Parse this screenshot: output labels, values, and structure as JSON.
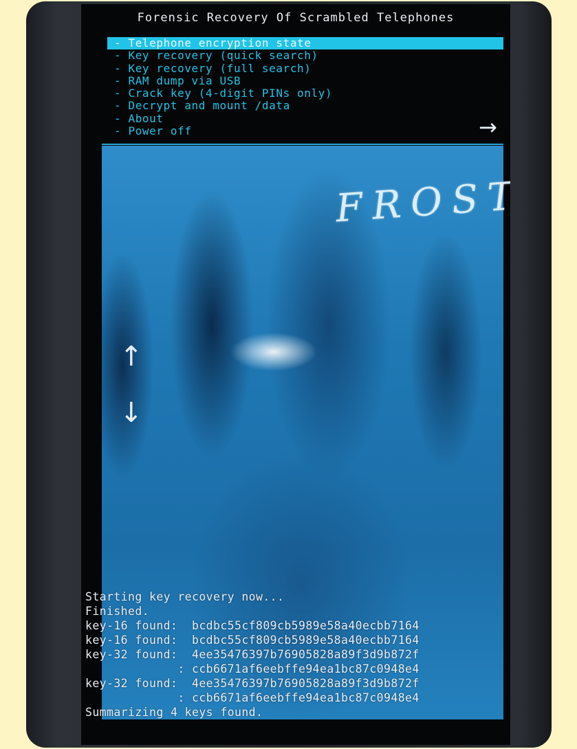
{
  "app": {
    "title": "Forensic Recovery Of Scrambled Telephones",
    "logo_text": "FROST"
  },
  "menu": {
    "selected_index": 0,
    "items": [
      {
        "label": "- Telephone encryption state"
      },
      {
        "label": "- Key recovery (quick search)"
      },
      {
        "label": "- Key recovery (full search)"
      },
      {
        "label": "- RAM dump via USB"
      },
      {
        "label": "- Crack key (4-digit PINs only)"
      },
      {
        "label": "- Decrypt and mount /data"
      },
      {
        "label": "- About"
      },
      {
        "label": "- Power off"
      }
    ]
  },
  "icons": {
    "next": "arrow-right-icon",
    "scroll_up": "arrow-up-icon",
    "scroll_down": "arrow-down-icon"
  },
  "colors": {
    "accent": "#21c4e6",
    "text": "#e8eef4",
    "background": "#050608"
  },
  "console": {
    "lines": [
      "Starting key recovery now...",
      "Finished.",
      "key-16 found:  bcdbc55cf809cb5989e58a40ecbb7164",
      "key-16 found:  bcdbc55cf809cb5989e58a40ecbb7164",
      "key-32 found:  4ee35476397b76905828a89f3d9b872f",
      "             : ccb6671af6eebffe94ea1bc87c0948e4",
      "key-32 found:  4ee35476397b76905828a89f3d9b872f",
      "             : ccb6671af6eebffe94ea1bc87c0948e4",
      "Summarizing 4 keys found."
    ]
  }
}
